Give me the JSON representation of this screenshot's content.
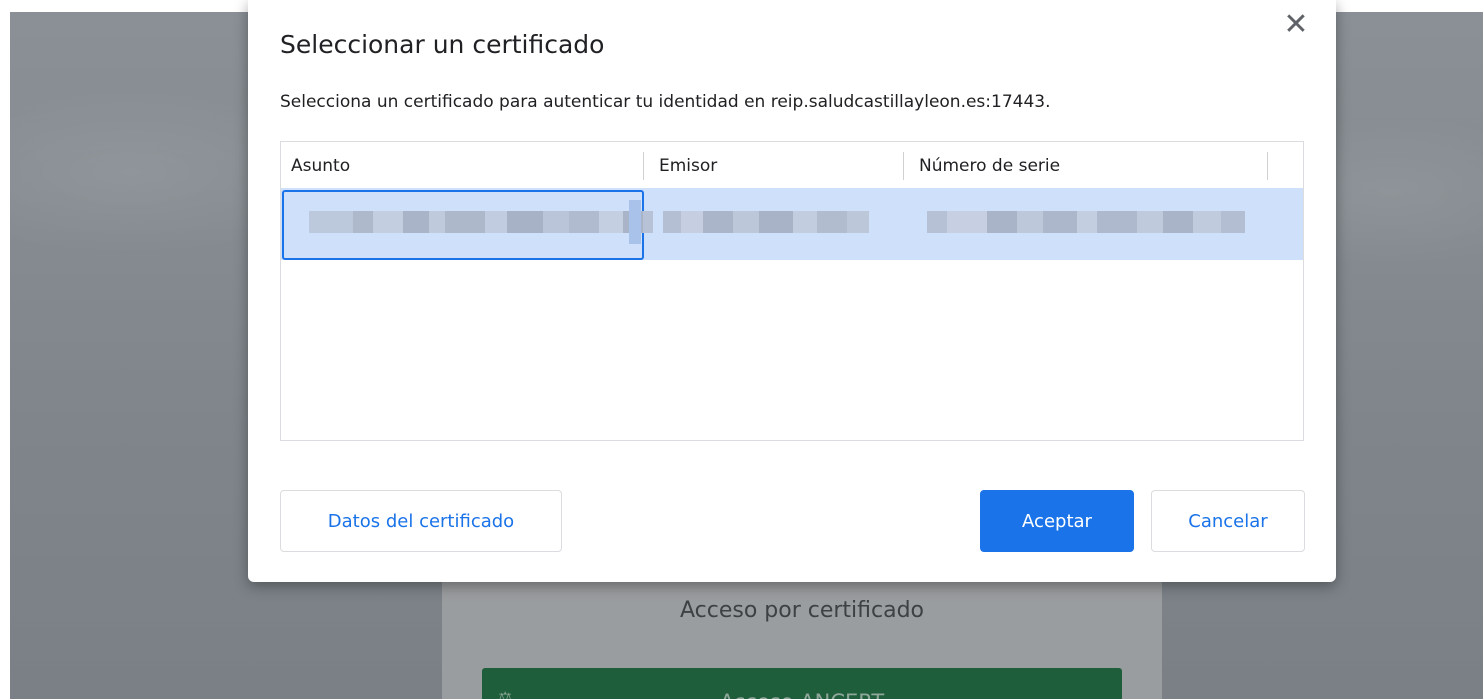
{
  "dialog": {
    "title": "Seleccionar un certificado",
    "description": "Selecciona un certificado para autenticar tu identidad en reip.saludcastillayleon.es:17443.",
    "close_glyph": "✕"
  },
  "table": {
    "columns": [
      "Asunto",
      "Emisor",
      "Número de serie"
    ],
    "rows": [
      {
        "asunto": "",
        "emisor": "",
        "numero_serie": "",
        "selected": true
      }
    ]
  },
  "footer": {
    "details_label": "Datos del certificado",
    "accept_label": "Aceptar",
    "cancel_label": "Cancelar"
  },
  "background_page": {
    "access_heading": "Acceso por certificado",
    "ancert_label": "Acceso ANCERT",
    "ancert_icon": "scale-icon",
    "ancert_color": "#1f5e3b"
  },
  "colors": {
    "accent": "#1a73e8",
    "selected_row": "#cfe0fb"
  },
  "icons": {
    "close": "close-icon"
  }
}
